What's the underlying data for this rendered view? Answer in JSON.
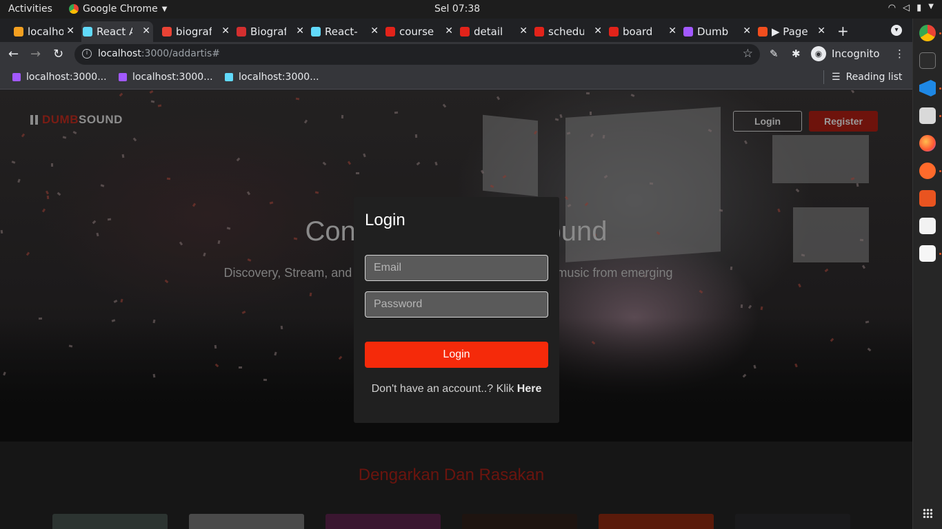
{
  "system": {
    "activities": "Activities",
    "app_name": "Google Chrome",
    "clock": "Sel 07:38"
  },
  "browser": {
    "tabs": [
      {
        "label": "localhost",
        "favicon_color": "#f4a020"
      },
      {
        "label": "React App",
        "favicon_color": "#61dafb",
        "active": true
      },
      {
        "label": "biografi",
        "favicon_color": "#ea4335"
      },
      {
        "label": "Biografi",
        "favicon_color": "#d32f2f"
      },
      {
        "label": "React-",
        "favicon_color": "#61dafb"
      },
      {
        "label": "course",
        "favicon_color": "#e2231a"
      },
      {
        "label": "detail",
        "favicon_color": "#e2231a"
      },
      {
        "label": "schedule",
        "favicon_color": "#e2231a"
      },
      {
        "label": "board",
        "favicon_color": "#e2231a"
      },
      {
        "label": "Dumb",
        "favicon_color": "#a259ff"
      },
      {
        "label": "▶ Page",
        "favicon_color": "#f24e1e"
      }
    ],
    "url_host": "localhost",
    "url_rest": ":3000/addartis#",
    "profile_label": "Incognito",
    "bookmarks": [
      {
        "label": "localhost:3000...",
        "favicon_color": "#a259ff"
      },
      {
        "label": "localhost:3000...",
        "favicon_color": "#a259ff"
      },
      {
        "label": "localhost:3000...",
        "favicon_color": "#61dafb"
      }
    ],
    "reading_list": "Reading list"
  },
  "page": {
    "logo_dumb": "DUMB",
    "logo_sound": "SOUND",
    "header_login": "Login",
    "header_register": "Register",
    "hero_title": "Connect on DumbSound",
    "hero_subtitle": "Discovery, Stream, and share a constantly expanding mix of music from emerging",
    "section_title": "Dengarkan Dan Rasakan"
  },
  "modal": {
    "title": "Login",
    "email_placeholder": "Email",
    "password_placeholder": "Password",
    "submit_label": "Login",
    "signup_prefix": "Don't have an account..? Klik ",
    "signup_link": "Here"
  },
  "colors": {
    "accent": "#f52a0a",
    "brand_dark": "#6e130c",
    "modal_bg": "#202020"
  }
}
